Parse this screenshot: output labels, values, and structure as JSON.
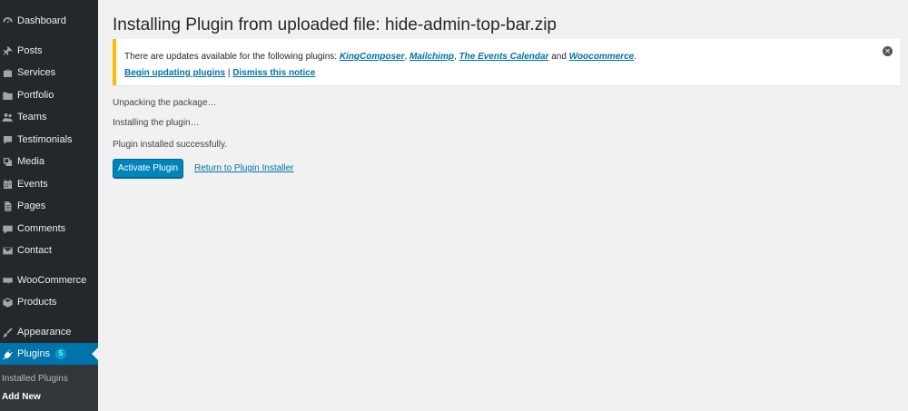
{
  "sidebar": {
    "items": [
      {
        "label": "Dashboard",
        "icon": "dashboard-icon"
      },
      {
        "label": "Posts",
        "icon": "pin-icon"
      },
      {
        "label": "Services",
        "icon": "briefcase-icon"
      },
      {
        "label": "Portfolio",
        "icon": "folder-icon"
      },
      {
        "label": "Teams",
        "icon": "users-icon"
      },
      {
        "label": "Testimonials",
        "icon": "quote-icon"
      },
      {
        "label": "Media",
        "icon": "media-icon"
      },
      {
        "label": "Events",
        "icon": "calendar-icon"
      },
      {
        "label": "Pages",
        "icon": "page-icon"
      },
      {
        "label": "Comments",
        "icon": "comment-icon"
      },
      {
        "label": "Contact",
        "icon": "mail-icon"
      },
      {
        "label": "WooCommerce",
        "icon": "woo-icon"
      },
      {
        "label": "Products",
        "icon": "box-icon"
      },
      {
        "label": "Appearance",
        "icon": "brush-icon"
      },
      {
        "label": "Plugins",
        "icon": "plug-icon",
        "badge": "5"
      }
    ],
    "submenu": [
      {
        "label": "Installed Plugins"
      },
      {
        "label": "Add New"
      }
    ]
  },
  "main": {
    "title": "Installing Plugin from uploaded file: hide-admin-top-bar.zip",
    "notice": {
      "prefix": "There are updates available for the following plugins: ",
      "plugins": [
        "KingComposer",
        "Mailchimp",
        "The Events Calendar",
        "Woocommerce"
      ],
      "sep1": ", ",
      "sep2": ", ",
      "and": " and ",
      "end": ".",
      "begin_link": "Begin updating plugins",
      "divider": " | ",
      "dismiss_link": "Dismiss this notice",
      "close_glyph": "✕"
    },
    "status_lines": [
      "Unpacking the package…",
      "Installing the plugin…",
      "Plugin installed successfully."
    ],
    "activate_button": "Activate Plugin",
    "return_link": "Return to Plugin Installer"
  },
  "colors": {
    "sidebar_bg": "#23282d",
    "active_bg": "#0073aa",
    "accent_link": "#0073aa",
    "notice_border": "#ffb900",
    "button_bg": "#0085ba"
  }
}
